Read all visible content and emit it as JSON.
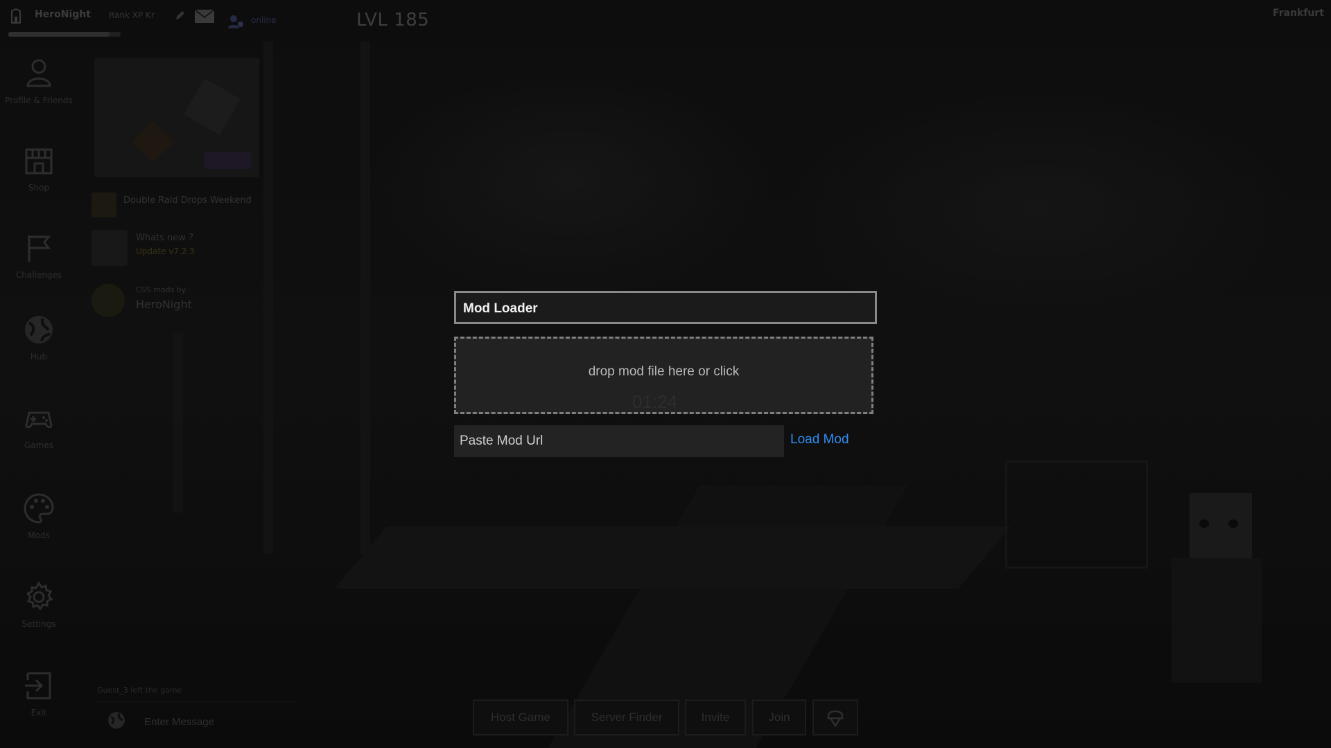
{
  "topbar": {
    "username": "HeroNight",
    "xp_text": "Rank XP",
    "kr_text": "Kr",
    "online_text": "online",
    "online_count": "",
    "level": "LVL 185",
    "xp_progress": 0.9,
    "region": "Frankfurt",
    "fps": ""
  },
  "sidebar": {
    "items": [
      {
        "label": "Profile & Friends",
        "icon": "person-icon"
      },
      {
        "label": "Shop",
        "icon": "store-icon"
      },
      {
        "label": "Challenges",
        "icon": "flag-icon"
      },
      {
        "label": "Hub",
        "icon": "globe-icon"
      },
      {
        "label": "Games",
        "icon": "gamepad-icon"
      },
      {
        "label": "Mods",
        "icon": "palette-icon"
      },
      {
        "label": "Settings",
        "icon": "gear-icon"
      },
      {
        "label": "Exit",
        "icon": "exit-icon"
      }
    ]
  },
  "news": {
    "card_title": "",
    "card_price": "",
    "items": [
      {
        "title": "Double Raid Drops Weekend",
        "subtitle": ""
      },
      {
        "title": "Whats new ?",
        "subtitle": "Update v7.2.3"
      },
      {
        "title": "CSS mods by",
        "subtitle": "HeroNight"
      }
    ]
  },
  "chat": {
    "message": "Guest_3 left the game",
    "placeholder": "Enter Message"
  },
  "bottom_buttons": [
    "Host Game",
    "Server Finder",
    "Invite",
    "Join"
  ],
  "modal": {
    "title": "Mod Loader",
    "dropzone_text": "drop mod file here or click",
    "url_placeholder": "Paste Mod Url",
    "load_label": "Load Mod",
    "background_timer": "01:24"
  },
  "colors": {
    "accent_link": "#2f8cf0",
    "modal_border": "#8a8a8a"
  }
}
